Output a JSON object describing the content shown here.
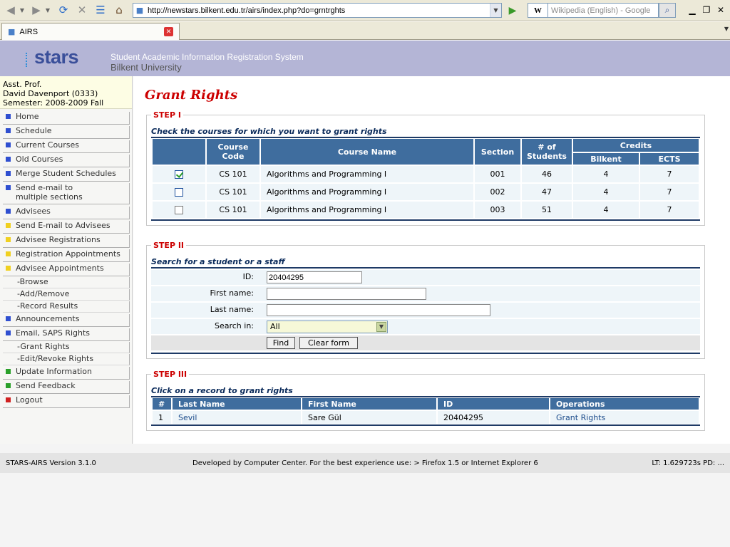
{
  "browser": {
    "url": "http://newstars.bilkent.edu.tr/airs/index.php?do=grntrghts",
    "search_placeholder": "Wikipedia (English) - Google",
    "search_engine_label": "W",
    "tab_title": "AIRS",
    "icons": [
      "back-icon",
      "forward-icon",
      "reload-icon",
      "stop-icon",
      "bookmarks-icon",
      "home-icon",
      "go-icon",
      "search-icon",
      "close-icon"
    ]
  },
  "header": {
    "logo": "stars",
    "title": "Student Academic Information Registration System",
    "subtitle": "Bilkent University"
  },
  "user": {
    "line1": "Asst. Prof.",
    "line2": "David Davenport (0333)",
    "line3": "Semester: 2008-2009 Fall"
  },
  "menu": {
    "home": "Home",
    "schedule": "Schedule",
    "current_courses": "Current Courses",
    "old_courses": "Old Courses",
    "merge": "Merge Student Schedules",
    "send_email_1": "Send e-mail to",
    "send_email_2": "multiple sections",
    "advisees": "Advisees",
    "send_email_advisees": "Send E-mail to Advisees",
    "advisee_registrations": "Advisee Registrations",
    "registration_appointments": "Registration Appointments",
    "advisee_appointments": "Advisee Appointments",
    "browse": "-Browse",
    "add_remove": "-Add/Remove",
    "record_results": "-Record Results",
    "announcements": "Announcements",
    "email_saps": "Email, SAPS Rights",
    "grant_rights": "-Grant Rights",
    "edit_revoke": "-Edit/Revoke Rights",
    "update_info": "Update Information",
    "send_feedback": "Send Feedback",
    "logout": "Logout"
  },
  "page": {
    "title": "Grant Rights"
  },
  "step1": {
    "legend": "STEP I",
    "caption": "Check the courses for which you want to grant rights",
    "headers": {
      "course_code_1": "Course",
      "course_code_2": "Code",
      "course_name": "Course Name",
      "section": "Section",
      "students_1": "# of",
      "students_2": "Students",
      "credits": "Credits",
      "bilkent": "Bilkent",
      "ects": "ECTS"
    },
    "rows": [
      {
        "checked": true,
        "code": "CS 101",
        "name": "Algorithms and Programming I",
        "section": "001",
        "students": "46",
        "bilkent": "4",
        "ects": "7"
      },
      {
        "checked": false,
        "code": "CS 101",
        "name": "Algorithms and Programming I",
        "section": "002",
        "students": "47",
        "bilkent": "4",
        "ects": "7"
      },
      {
        "checked": false,
        "code": "CS 101",
        "name": "Algorithms and Programming I",
        "section": "003",
        "students": "51",
        "bilkent": "4",
        "ects": "7"
      }
    ]
  },
  "step2": {
    "legend": "STEP II",
    "caption": "Search for a student or a staff",
    "id_label": "ID:",
    "id_value": "20404295",
    "first_name_label": "First name:",
    "first_name_value": "",
    "last_name_label": "Last name:",
    "last_name_value": "",
    "search_in_label": "Search in:",
    "search_in_value": "All",
    "find_button": "Find",
    "clear_button": "Clear form"
  },
  "step3": {
    "legend": "STEP III",
    "caption": "Click on a record to grant rights",
    "headers": {
      "num": "#",
      "last_name": "Last Name",
      "first_name": "First Name",
      "id": "ID",
      "operations": "Operations"
    },
    "rows": [
      {
        "num": "1",
        "last_name": "Sevil",
        "first_name": "Sare Gül",
        "id": "20404295",
        "operation": "Grant Rights"
      }
    ]
  },
  "footer": {
    "version": "STARS-AIRS Version 3.1.0",
    "developed": "Developed by Computer Center. For the best experience use: > Firefox 1.5 or Internet Explorer 6",
    "timing": "LT: 1.629723s PD: ..."
  },
  "colors": {
    "header_bg": "#b4b5d6",
    "table_header": "#3f6d9e",
    "title_red": "#cc0000",
    "bullet_blue": "#2f4fd0",
    "bullet_yellow": "#f0d020",
    "bullet_green": "#2aa02a",
    "bullet_red": "#d02020"
  }
}
